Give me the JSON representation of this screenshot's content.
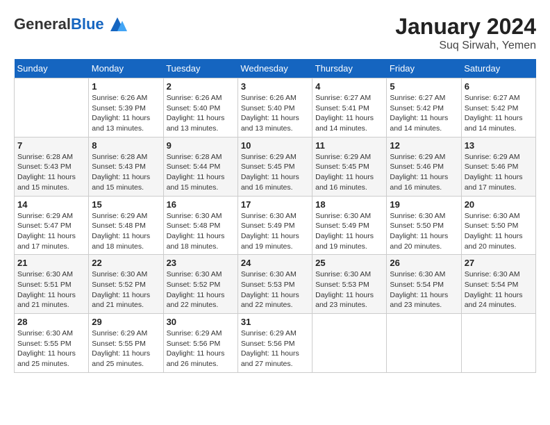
{
  "logo": {
    "general": "General",
    "blue": "Blue"
  },
  "header": {
    "month": "January 2024",
    "location": "Suq Sirwah, Yemen"
  },
  "weekdays": [
    "Sunday",
    "Monday",
    "Tuesday",
    "Wednesday",
    "Thursday",
    "Friday",
    "Saturday"
  ],
  "weeks": [
    [
      {
        "day": "",
        "sunrise": "",
        "sunset": "",
        "daylight": ""
      },
      {
        "day": "1",
        "sunrise": "Sunrise: 6:26 AM",
        "sunset": "Sunset: 5:39 PM",
        "daylight": "Daylight: 11 hours and 13 minutes."
      },
      {
        "day": "2",
        "sunrise": "Sunrise: 6:26 AM",
        "sunset": "Sunset: 5:40 PM",
        "daylight": "Daylight: 11 hours and 13 minutes."
      },
      {
        "day": "3",
        "sunrise": "Sunrise: 6:26 AM",
        "sunset": "Sunset: 5:40 PM",
        "daylight": "Daylight: 11 hours and 13 minutes."
      },
      {
        "day": "4",
        "sunrise": "Sunrise: 6:27 AM",
        "sunset": "Sunset: 5:41 PM",
        "daylight": "Daylight: 11 hours and 14 minutes."
      },
      {
        "day": "5",
        "sunrise": "Sunrise: 6:27 AM",
        "sunset": "Sunset: 5:42 PM",
        "daylight": "Daylight: 11 hours and 14 minutes."
      },
      {
        "day": "6",
        "sunrise": "Sunrise: 6:27 AM",
        "sunset": "Sunset: 5:42 PM",
        "daylight": "Daylight: 11 hours and 14 minutes."
      }
    ],
    [
      {
        "day": "7",
        "sunrise": "Sunrise: 6:28 AM",
        "sunset": "Sunset: 5:43 PM",
        "daylight": "Daylight: 11 hours and 15 minutes."
      },
      {
        "day": "8",
        "sunrise": "Sunrise: 6:28 AM",
        "sunset": "Sunset: 5:43 PM",
        "daylight": "Daylight: 11 hours and 15 minutes."
      },
      {
        "day": "9",
        "sunrise": "Sunrise: 6:28 AM",
        "sunset": "Sunset: 5:44 PM",
        "daylight": "Daylight: 11 hours and 15 minutes."
      },
      {
        "day": "10",
        "sunrise": "Sunrise: 6:29 AM",
        "sunset": "Sunset: 5:45 PM",
        "daylight": "Daylight: 11 hours and 16 minutes."
      },
      {
        "day": "11",
        "sunrise": "Sunrise: 6:29 AM",
        "sunset": "Sunset: 5:45 PM",
        "daylight": "Daylight: 11 hours and 16 minutes."
      },
      {
        "day": "12",
        "sunrise": "Sunrise: 6:29 AM",
        "sunset": "Sunset: 5:46 PM",
        "daylight": "Daylight: 11 hours and 16 minutes."
      },
      {
        "day": "13",
        "sunrise": "Sunrise: 6:29 AM",
        "sunset": "Sunset: 5:46 PM",
        "daylight": "Daylight: 11 hours and 17 minutes."
      }
    ],
    [
      {
        "day": "14",
        "sunrise": "Sunrise: 6:29 AM",
        "sunset": "Sunset: 5:47 PM",
        "daylight": "Daylight: 11 hours and 17 minutes."
      },
      {
        "day": "15",
        "sunrise": "Sunrise: 6:29 AM",
        "sunset": "Sunset: 5:48 PM",
        "daylight": "Daylight: 11 hours and 18 minutes."
      },
      {
        "day": "16",
        "sunrise": "Sunrise: 6:30 AM",
        "sunset": "Sunset: 5:48 PM",
        "daylight": "Daylight: 11 hours and 18 minutes."
      },
      {
        "day": "17",
        "sunrise": "Sunrise: 6:30 AM",
        "sunset": "Sunset: 5:49 PM",
        "daylight": "Daylight: 11 hours and 19 minutes."
      },
      {
        "day": "18",
        "sunrise": "Sunrise: 6:30 AM",
        "sunset": "Sunset: 5:49 PM",
        "daylight": "Daylight: 11 hours and 19 minutes."
      },
      {
        "day": "19",
        "sunrise": "Sunrise: 6:30 AM",
        "sunset": "Sunset: 5:50 PM",
        "daylight": "Daylight: 11 hours and 20 minutes."
      },
      {
        "day": "20",
        "sunrise": "Sunrise: 6:30 AM",
        "sunset": "Sunset: 5:50 PM",
        "daylight": "Daylight: 11 hours and 20 minutes."
      }
    ],
    [
      {
        "day": "21",
        "sunrise": "Sunrise: 6:30 AM",
        "sunset": "Sunset: 5:51 PM",
        "daylight": "Daylight: 11 hours and 21 minutes."
      },
      {
        "day": "22",
        "sunrise": "Sunrise: 6:30 AM",
        "sunset": "Sunset: 5:52 PM",
        "daylight": "Daylight: 11 hours and 21 minutes."
      },
      {
        "day": "23",
        "sunrise": "Sunrise: 6:30 AM",
        "sunset": "Sunset: 5:52 PM",
        "daylight": "Daylight: 11 hours and 22 minutes."
      },
      {
        "day": "24",
        "sunrise": "Sunrise: 6:30 AM",
        "sunset": "Sunset: 5:53 PM",
        "daylight": "Daylight: 11 hours and 22 minutes."
      },
      {
        "day": "25",
        "sunrise": "Sunrise: 6:30 AM",
        "sunset": "Sunset: 5:53 PM",
        "daylight": "Daylight: 11 hours and 23 minutes."
      },
      {
        "day": "26",
        "sunrise": "Sunrise: 6:30 AM",
        "sunset": "Sunset: 5:54 PM",
        "daylight": "Daylight: 11 hours and 23 minutes."
      },
      {
        "day": "27",
        "sunrise": "Sunrise: 6:30 AM",
        "sunset": "Sunset: 5:54 PM",
        "daylight": "Daylight: 11 hours and 24 minutes."
      }
    ],
    [
      {
        "day": "28",
        "sunrise": "Sunrise: 6:30 AM",
        "sunset": "Sunset: 5:55 PM",
        "daylight": "Daylight: 11 hours and 25 minutes."
      },
      {
        "day": "29",
        "sunrise": "Sunrise: 6:29 AM",
        "sunset": "Sunset: 5:55 PM",
        "daylight": "Daylight: 11 hours and 25 minutes."
      },
      {
        "day": "30",
        "sunrise": "Sunrise: 6:29 AM",
        "sunset": "Sunset: 5:56 PM",
        "daylight": "Daylight: 11 hours and 26 minutes."
      },
      {
        "day": "31",
        "sunrise": "Sunrise: 6:29 AM",
        "sunset": "Sunset: 5:56 PM",
        "daylight": "Daylight: 11 hours and 27 minutes."
      },
      {
        "day": "",
        "sunrise": "",
        "sunset": "",
        "daylight": ""
      },
      {
        "day": "",
        "sunrise": "",
        "sunset": "",
        "daylight": ""
      },
      {
        "day": "",
        "sunrise": "",
        "sunset": "",
        "daylight": ""
      }
    ]
  ]
}
